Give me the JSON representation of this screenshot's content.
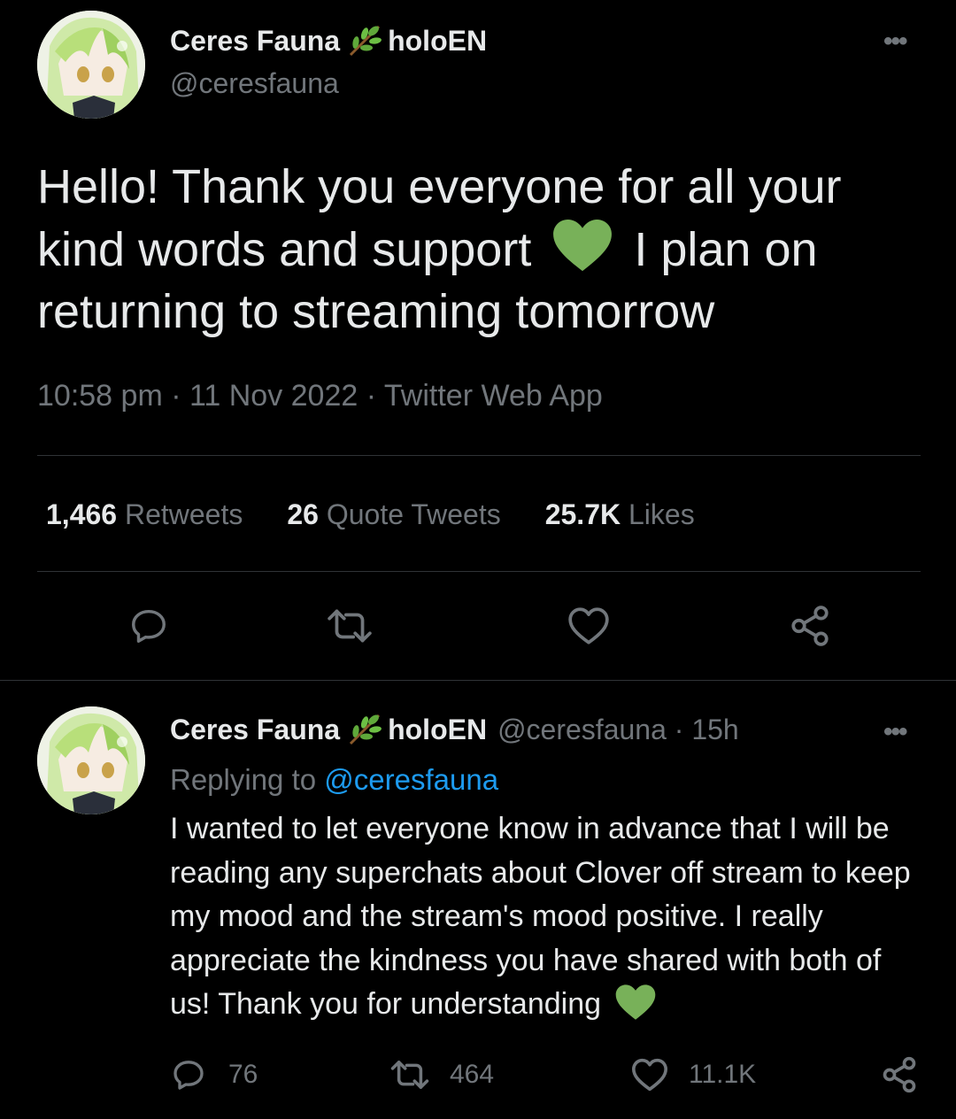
{
  "main_tweet": {
    "author_name": "Ceres Fauna",
    "author_suffix": "holoEN",
    "author_handle": "@ceresfauna",
    "text_part1": "Hello! Thank you everyone for all your kind words and support",
    "text_part2": "I plan on returning to streaming tomorrow",
    "time": "10:58 pm",
    "date": "11 Nov 2022",
    "source": "Twitter Web App",
    "stats": {
      "retweets_count": "1,466",
      "retweets_label": "Retweets",
      "quotes_count": "26",
      "quotes_label": "Quote Tweets",
      "likes_count": "25.7K",
      "likes_label": "Likes"
    },
    "more_label": "•••"
  },
  "reply_tweet": {
    "author_name": "Ceres Fauna",
    "author_suffix": "holoEN",
    "author_handle": "@ceresfauna",
    "age": "15h",
    "replying_to_prefix": "Replying to",
    "replying_to_handle": "@ceresfauna",
    "text": "I wanted to let everyone know in advance that I will be reading any superchats about Clover off stream to keep my mood and the stream's mood positive. I really appreciate the kindness you have shared with both of us! Thank you for understanding",
    "replies_count": "76",
    "retweets_count": "464",
    "likes_count": "11.1K",
    "more_label": "•••"
  },
  "icons": {
    "reply": "reply-icon",
    "retweet": "retweet-icon",
    "like": "heart-icon",
    "share": "share-icon",
    "emoji": "green-heart-emoji",
    "badge": "herb-sprig-emoji"
  },
  "colors": {
    "background": "#000000",
    "text": "#e7e9ea",
    "muted": "#71767b",
    "link": "#1d9bf0",
    "heart_emoji": "#78b159"
  }
}
